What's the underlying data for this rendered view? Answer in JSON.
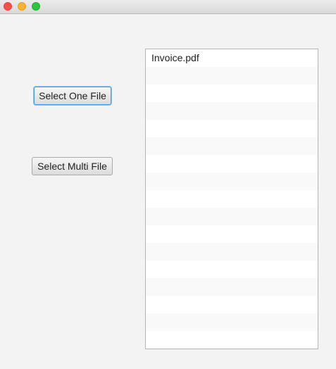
{
  "window": {
    "traffic_lights": {
      "close_color": "#fc4e45",
      "minimize_color": "#fdb325",
      "maximize_color": "#2ac73e"
    }
  },
  "buttons": {
    "select_one": "Select One File",
    "select_multi": "Select Multi File"
  },
  "file_list": {
    "items": [
      "Invoice.pdf"
    ],
    "focus_color": "#3b99fc"
  }
}
